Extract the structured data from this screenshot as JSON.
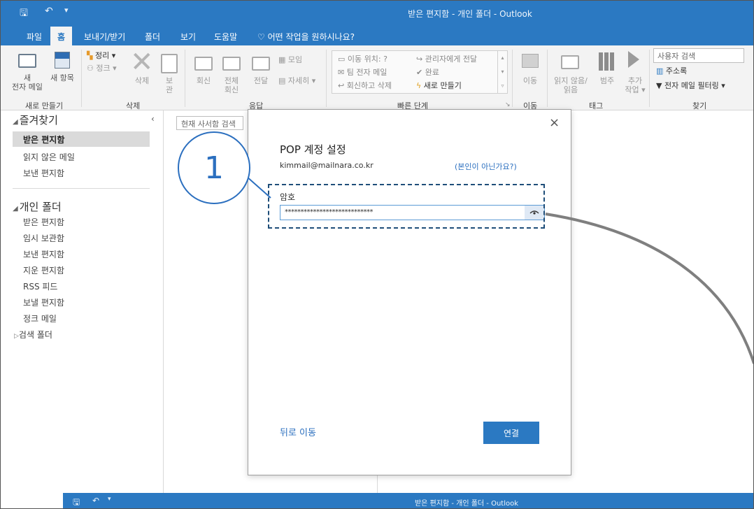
{
  "window": {
    "title": "받은 편지함 - 개인 폴더  -  Outlook"
  },
  "menu": {
    "file": "파일",
    "home": "홈",
    "send_receive": "보내기/받기",
    "folder": "폴더",
    "view": "보기",
    "help": "도움말",
    "tell_me": "어떤 작업을 원하시나요?"
  },
  "ribbon": {
    "new_email_1": "새",
    "new_email_2": "전자 메일",
    "new_items": "새 항목",
    "cleanup": "정리 ▾",
    "junk": "정크 ▾",
    "delete": "삭제",
    "archive_1": "보",
    "archive_2": "관",
    "reply": "회신",
    "reply_all_1": "전체",
    "reply_all_2": "회신",
    "forward": "전달",
    "meeting": "모임",
    "more": "자세히 ▾",
    "qs_move_to": "이동 위치: ?",
    "qs_team_email": "팀 전자 메일",
    "qs_reply_delete": "회신하고 삭제",
    "qs_to_manager": "관리자에게 전달",
    "qs_done": "완료",
    "qs_create_new": "새로 만들기",
    "move": "이동",
    "unread_read_1": "읽지 않음/",
    "unread_read_2": "읽음",
    "categorize": "범주",
    "followup_1": "추가",
    "followup_2": "작업 ▾",
    "search_people": "사용자 검색",
    "address_book": "주소록",
    "filter_email": "전자 메일 필터링 ▾",
    "groups": {
      "new": "새로 만들기",
      "delete": "삭제",
      "respond": "응답",
      "quick_steps": "빠른 단계",
      "move": "이동",
      "tags": "태그",
      "find": "찾기"
    }
  },
  "folders": {
    "favorites": "즐겨찾기",
    "fav_items": [
      "받은 편지함",
      "읽지 않은 메일",
      "보낸 편지함"
    ],
    "personal": "개인 폴더",
    "personal_items": [
      "받은 편지함",
      "임시 보관함",
      "보낸 편지함",
      "지운 편지함",
      "RSS 피드",
      "보낼 편지함",
      "정크 메일"
    ],
    "search_folders": "검색 폴더"
  },
  "message_list": {
    "search_placeholder": "현재 사서함 검색"
  },
  "dialog": {
    "title": "POP 계정 설정",
    "email": "kimmail@mailnara.co.kr",
    "not_you": "(본인이 아닌가요?)",
    "password_label": "암호",
    "password_value": "****************************",
    "back": "뒤로 이동",
    "connect": "연결",
    "close": "×"
  },
  "callout": {
    "number": "1"
  },
  "colors": {
    "accent": "#2b79c2",
    "link": "#2b6fbf",
    "callout_dark": "#1f4e79"
  }
}
